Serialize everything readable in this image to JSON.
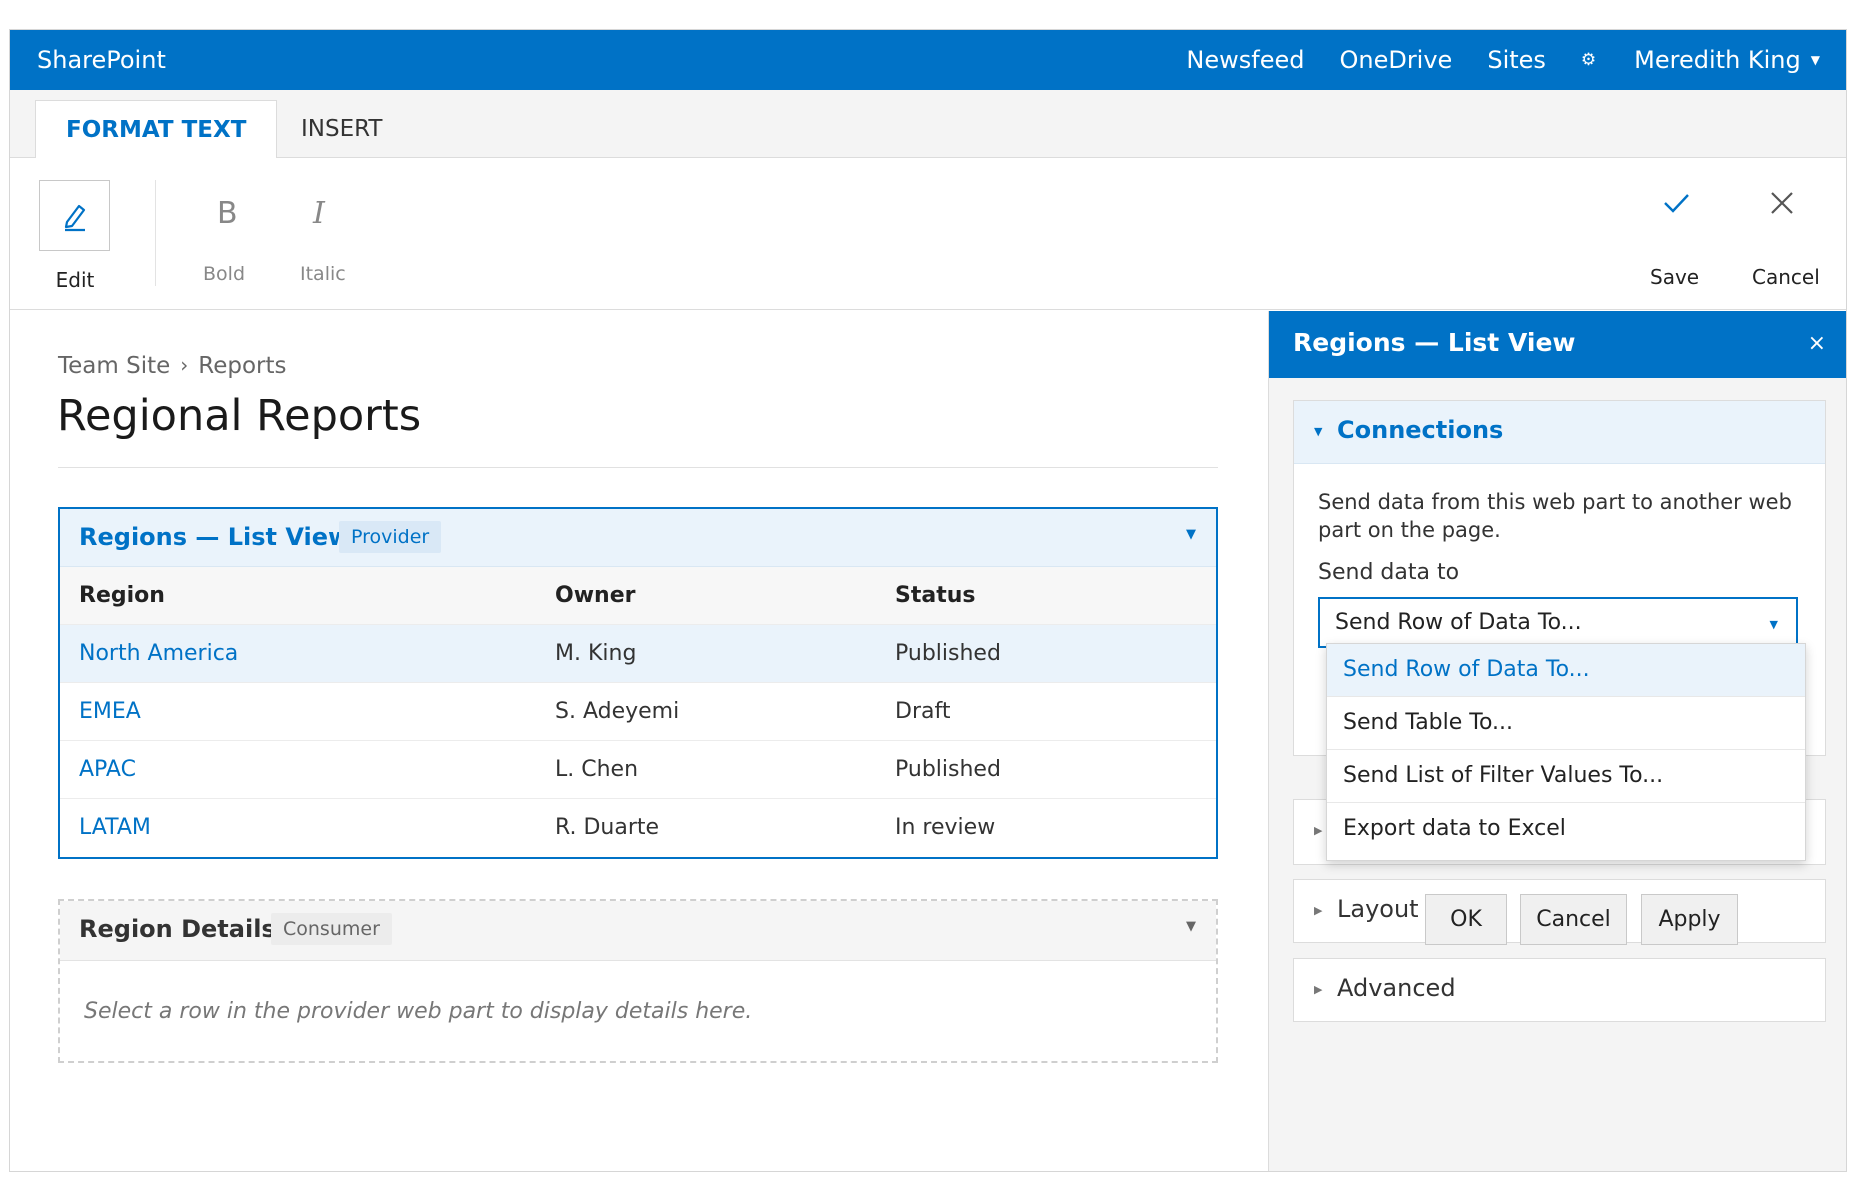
{
  "suitebar": {
    "brand": "SharePoint",
    "links": [
      "Newsfeed",
      "OneDrive",
      "Sites"
    ],
    "user": "Meredith King"
  },
  "ribbon": {
    "tabs": [
      "FORMAT TEXT",
      "INSERT"
    ],
    "edit_label": "Edit",
    "bold_glyph": "B",
    "bold_label": "Bold",
    "italic_glyph": "I",
    "italic_label": "Italic",
    "save_label": "Save",
    "cancel_label": "Cancel"
  },
  "main": {
    "breadcrumb": [
      "Team Site",
      "Reports"
    ],
    "breadcrumb_sep": "›",
    "title": "Regional Reports"
  },
  "provider": {
    "title": "Regions — List View",
    "badge": "Provider",
    "columns": [
      "Region",
      "Owner",
      "Status"
    ],
    "rows": [
      {
        "region": "North America",
        "owner": "M. King",
        "status": "Published"
      },
      {
        "region": "EMEA",
        "owner": "S. Adeyemi",
        "status": "Draft"
      },
      {
        "region": "APAC",
        "owner": "L. Chen",
        "status": "Published"
      },
      {
        "region": "LATAM",
        "owner": "R. Duarte",
        "status": "In review"
      }
    ],
    "selected_row": 0
  },
  "consumer": {
    "title": "Region Details",
    "badge": "Consumer",
    "message": "Select a row in the provider web part to display details here."
  },
  "toolpane": {
    "title": "Regions — List View",
    "close": "×",
    "connections": {
      "label": "Connections",
      "description": "Send data from this web part to another web part on the page.",
      "send_label": "Send data to",
      "selected": "Send Row of Data To..."
    },
    "dropdown_options": [
      "Send Row of Data To...",
      "Send Table To...",
      "Send List of Filter Values To...",
      "Export data to Excel"
    ],
    "sections": [
      "Layout",
      "Advanced"
    ],
    "buttons": {
      "ok": "OK",
      "cancel": "Cancel",
      "apply": "Apply"
    }
  },
  "colors": {
    "accent": "#0072c6",
    "selected_row_bg": "#eaf3fb"
  }
}
